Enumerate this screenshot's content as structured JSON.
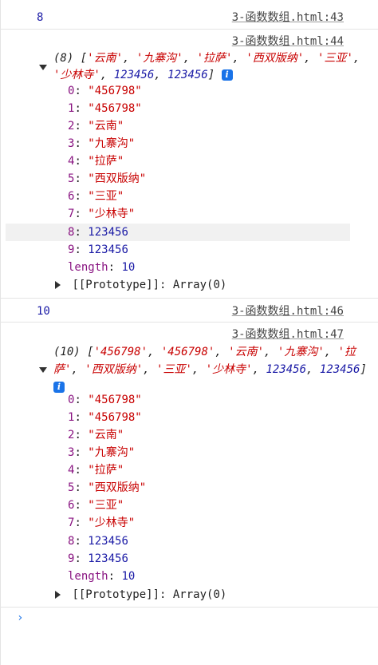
{
  "messages": [
    {
      "value": "8",
      "source": "3-函数数组.html:43"
    },
    {
      "source": "3-函数数组.html:44",
      "summary_count": "(8)",
      "summary_items": [
        "'云南'",
        "'九寨沟'",
        "'拉萨'",
        "'西双版纳'",
        "'三亚'",
        "'少林寺'",
        "123456",
        "123456"
      ],
      "entries": [
        {
          "key": "0",
          "value": "\"456798\"",
          "type": "string"
        },
        {
          "key": "1",
          "value": "\"456798\"",
          "type": "string"
        },
        {
          "key": "2",
          "value": "\"云南\"",
          "type": "string"
        },
        {
          "key": "3",
          "value": "\"九寨沟\"",
          "type": "string"
        },
        {
          "key": "4",
          "value": "\"拉萨\"",
          "type": "string"
        },
        {
          "key": "5",
          "value": "\"西双版纳\"",
          "type": "string"
        },
        {
          "key": "6",
          "value": "\"三亚\"",
          "type": "string"
        },
        {
          "key": "7",
          "value": "\"少林寺\"",
          "type": "string"
        },
        {
          "key": "8",
          "value": "123456",
          "type": "number"
        },
        {
          "key": "9",
          "value": "123456",
          "type": "number"
        }
      ],
      "length_key": "length",
      "length_value": "10",
      "prototype_label": "[[Prototype]]",
      "prototype_value": "Array(0)"
    },
    {
      "value": "10",
      "source": "3-函数数组.html:46"
    },
    {
      "source": "3-函数数组.html:47",
      "summary_count": "(10)",
      "summary_items": [
        "'456798'",
        "'456798'",
        "'云南'",
        "'九寨沟'",
        "'拉萨'",
        "'西双版纳'",
        "'三亚'",
        "'少林寺'",
        "123456",
        "123456"
      ],
      "entries": [
        {
          "key": "0",
          "value": "\"456798\"",
          "type": "string"
        },
        {
          "key": "1",
          "value": "\"456798\"",
          "type": "string"
        },
        {
          "key": "2",
          "value": "\"云南\"",
          "type": "string"
        },
        {
          "key": "3",
          "value": "\"九寨沟\"",
          "type": "string"
        },
        {
          "key": "4",
          "value": "\"拉萨\"",
          "type": "string"
        },
        {
          "key": "5",
          "value": "\"西双版纳\"",
          "type": "string"
        },
        {
          "key": "6",
          "value": "\"三亚\"",
          "type": "string"
        },
        {
          "key": "7",
          "value": "\"少林寺\"",
          "type": "string"
        },
        {
          "key": "8",
          "value": "123456",
          "type": "number"
        },
        {
          "key": "9",
          "value": "123456",
          "type": "number"
        }
      ],
      "length_key": "length",
      "length_value": "10",
      "prototype_label": "[[Prototype]]",
      "prototype_value": "Array(0)"
    }
  ],
  "info_icon_glyph": "i",
  "prompt_glyph": "›",
  "colors": {
    "key": "#881280",
    "string": "#c80000",
    "number": "#1a1aa6",
    "info_icon": "#1a73e8"
  }
}
